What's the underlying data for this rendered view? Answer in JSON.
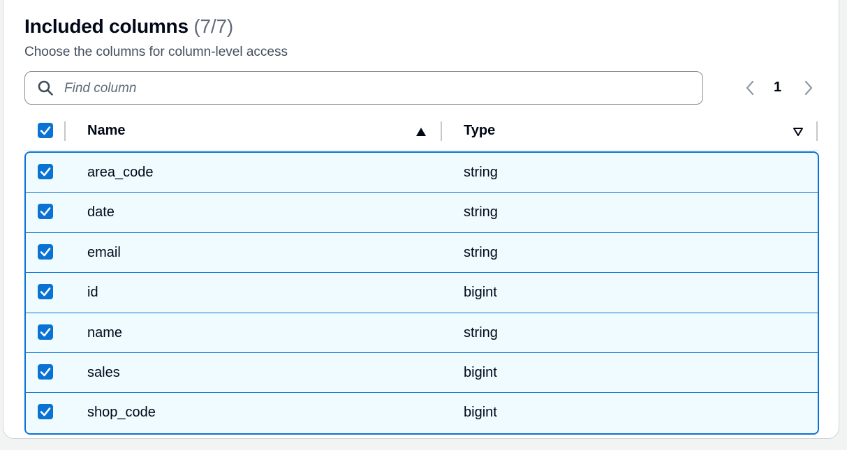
{
  "header": {
    "title": "Included columns",
    "count": "(7/7)",
    "description": "Choose the columns for column-level access"
  },
  "search": {
    "placeholder": "Find column",
    "value": "",
    "icon": "search-icon"
  },
  "pagination": {
    "current_page": "1",
    "prev_icon": "chevron-left-icon",
    "next_icon": "chevron-right-icon"
  },
  "table": {
    "columns": [
      {
        "label": "Name",
        "sort": "ascending",
        "sort_icon": "sort-ascending-icon"
      },
      {
        "label": "Type",
        "sort": "none",
        "sort_icon": "sort-descending-outline-icon"
      }
    ],
    "select_all_checked": true,
    "rows": [
      {
        "name": "area_code",
        "type": "string",
        "selected": true
      },
      {
        "name": "date",
        "type": "string",
        "selected": true
      },
      {
        "name": "email",
        "type": "string",
        "selected": true
      },
      {
        "name": "id",
        "type": "bigint",
        "selected": true
      },
      {
        "name": "name",
        "type": "string",
        "selected": true
      },
      {
        "name": "sales",
        "type": "bigint",
        "selected": true
      },
      {
        "name": "shop_code",
        "type": "bigint",
        "selected": true
      }
    ]
  },
  "colors": {
    "accent": "#0972d3",
    "selected_row_bg": "#f0fbff"
  }
}
